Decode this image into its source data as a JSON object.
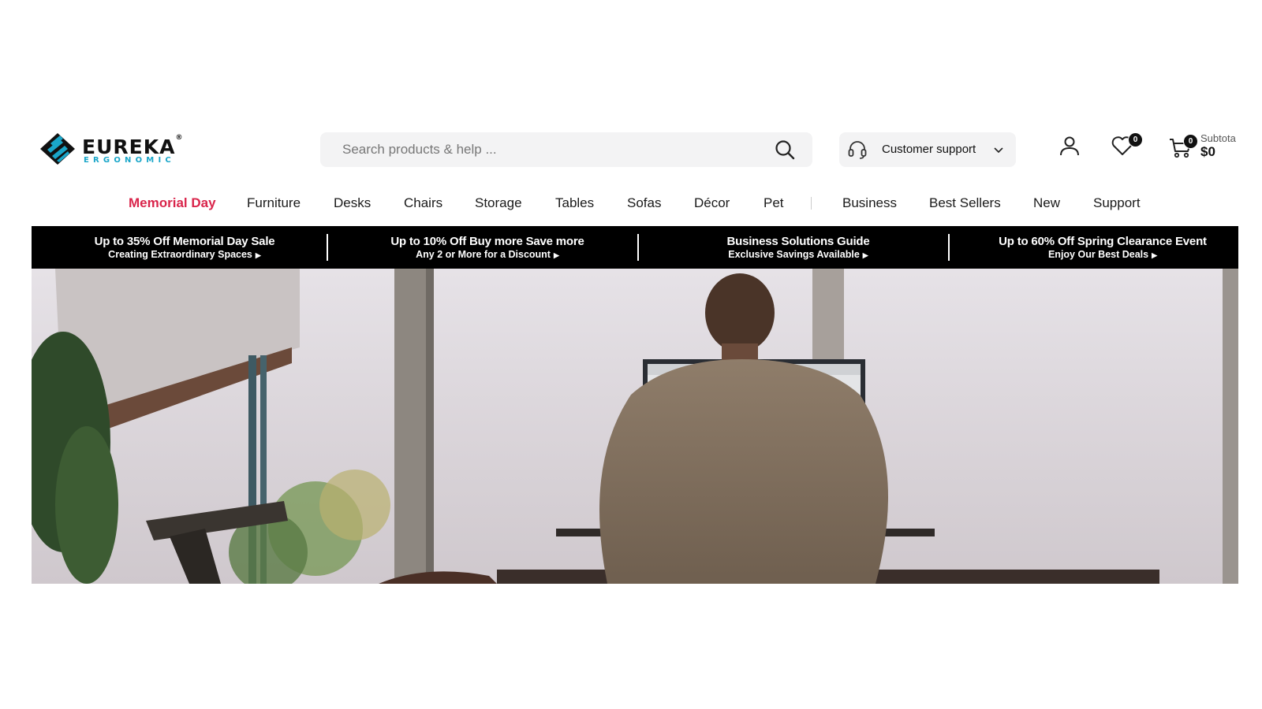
{
  "brand": {
    "name": "EUREKA",
    "tagline": "ERGONOMIC",
    "reg": "®"
  },
  "search": {
    "placeholder": "Search products & help ..."
  },
  "support": {
    "label": "Customer support"
  },
  "wishlist": {
    "count": "0"
  },
  "cart": {
    "count": "0",
    "subtotal_label": "Subtota",
    "subtotal_value": "$0"
  },
  "nav": {
    "items": [
      "Memorial Day",
      "Furniture",
      "Desks",
      "Chairs",
      "Storage",
      "Tables",
      "Sofas",
      "Décor",
      "Pet",
      "Business",
      "Best Sellers",
      "New",
      "Support"
    ]
  },
  "promos": [
    {
      "title": "Up to 35% Off Memorial Day Sale",
      "subtitle": "Creating Extraordinary Spaces"
    },
    {
      "title": "Up to 10% Off Buy more Save more",
      "subtitle": "Any 2 or More for a Discount"
    },
    {
      "title": "Business Solutions Guide",
      "subtitle": "Exclusive Savings Available"
    },
    {
      "title": "Up to 60% Off Spring Clearance Event",
      "subtitle": "Enjoy Our Best Deals"
    }
  ],
  "colors": {
    "promo_nav": "#d9254b",
    "brand_accent": "#1aa6c9",
    "promo_bar": "#000000"
  },
  "icons": [
    "search-icon",
    "headset-icon",
    "chevron-down-icon",
    "user-icon",
    "heart-icon",
    "cart-icon"
  ]
}
